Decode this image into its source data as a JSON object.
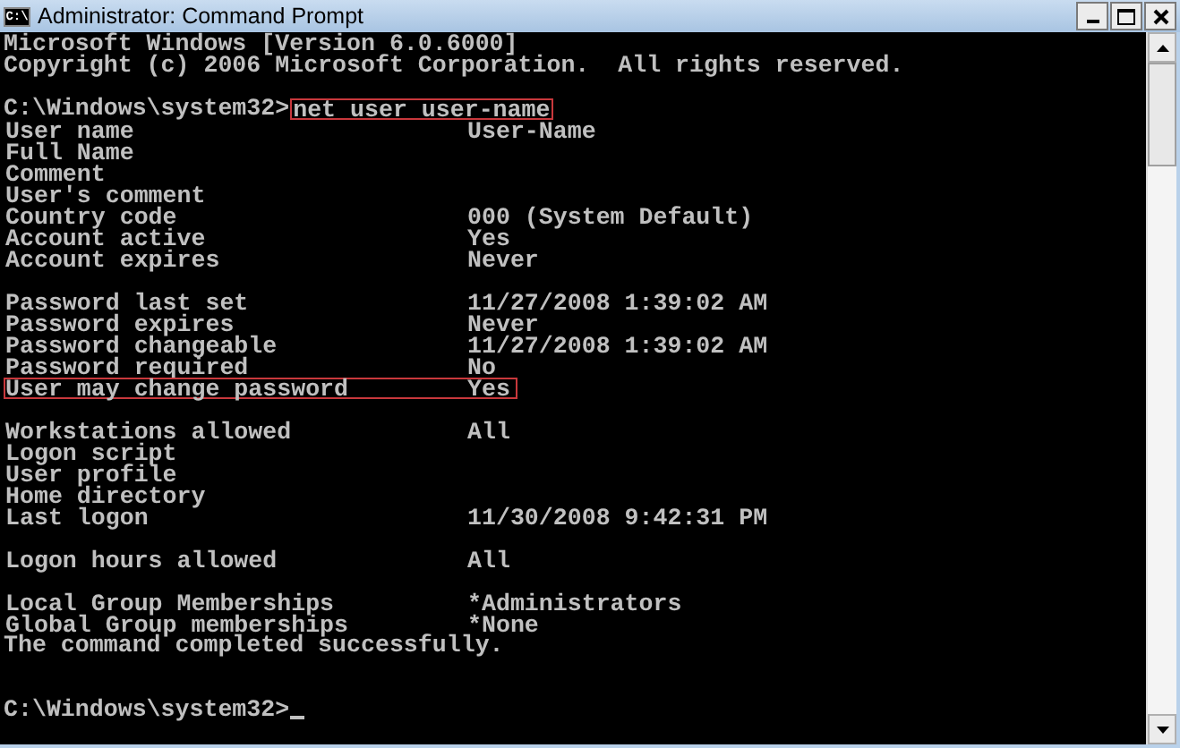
{
  "window": {
    "title": "Administrator: Command Prompt",
    "icon_text": "C:\\"
  },
  "console": {
    "lines": [
      {
        "kind": "text",
        "text": "Microsoft Windows [Version 6.0.6000]"
      },
      {
        "kind": "text",
        "text": "Copyright (c) 2006 Microsoft Corporation.  All rights reserved."
      },
      {
        "kind": "blank"
      },
      {
        "kind": "prompt",
        "prompt": "C:\\Windows\\system32>",
        "command": "net user user-name",
        "highlighted": true,
        "cursor": false
      },
      {
        "kind": "field",
        "label": "User name",
        "value": "User-Name",
        "highlighted": false
      },
      {
        "kind": "field",
        "label": "Full Name",
        "highlighted": false
      },
      {
        "kind": "field",
        "label": "Comment",
        "highlighted": false
      },
      {
        "kind": "field",
        "label": "User's comment",
        "highlighted": false
      },
      {
        "kind": "field",
        "label": "Country code",
        "value": "000 (System Default)",
        "highlighted": false
      },
      {
        "kind": "field",
        "label": "Account active",
        "value": "Yes",
        "highlighted": false
      },
      {
        "kind": "field",
        "label": "Account expires",
        "value": "Never",
        "highlighted": false
      },
      {
        "kind": "blank"
      },
      {
        "kind": "field",
        "label": "Password last set",
        "value": "11/27/2008 1:39:02 AM",
        "highlighted": false
      },
      {
        "kind": "field",
        "label": "Password expires",
        "value": "Never",
        "highlighted": false
      },
      {
        "kind": "field",
        "label": "Password changeable",
        "value": "11/27/2008 1:39:02 AM",
        "highlighted": false
      },
      {
        "kind": "field",
        "label": "Password required",
        "value": "No",
        "highlighted": false
      },
      {
        "kind": "field",
        "label": "User may change password",
        "value": "Yes",
        "highlighted": true
      },
      {
        "kind": "blank"
      },
      {
        "kind": "field",
        "label": "Workstations allowed",
        "value": "All",
        "highlighted": false
      },
      {
        "kind": "field",
        "label": "Logon script",
        "highlighted": false
      },
      {
        "kind": "field",
        "label": "User profile",
        "highlighted": false
      },
      {
        "kind": "field",
        "label": "Home directory",
        "highlighted": false
      },
      {
        "kind": "field",
        "label": "Last logon",
        "value": "11/30/2008 9:42:31 PM",
        "highlighted": false
      },
      {
        "kind": "blank"
      },
      {
        "kind": "field",
        "label": "Logon hours allowed",
        "value": "All",
        "highlighted": false
      },
      {
        "kind": "blank"
      },
      {
        "kind": "field",
        "label": "Local Group Memberships",
        "value": "*Administrators",
        "highlighted": false
      },
      {
        "kind": "field",
        "label": "Global Group memberships",
        "value": "*None",
        "highlighted": false
      },
      {
        "kind": "text",
        "text": "The command completed successfully."
      },
      {
        "kind": "blank"
      },
      {
        "kind": "blank"
      },
      {
        "kind": "prompt",
        "prompt": "C:\\Windows\\system32>",
        "cursor": true
      }
    ]
  }
}
